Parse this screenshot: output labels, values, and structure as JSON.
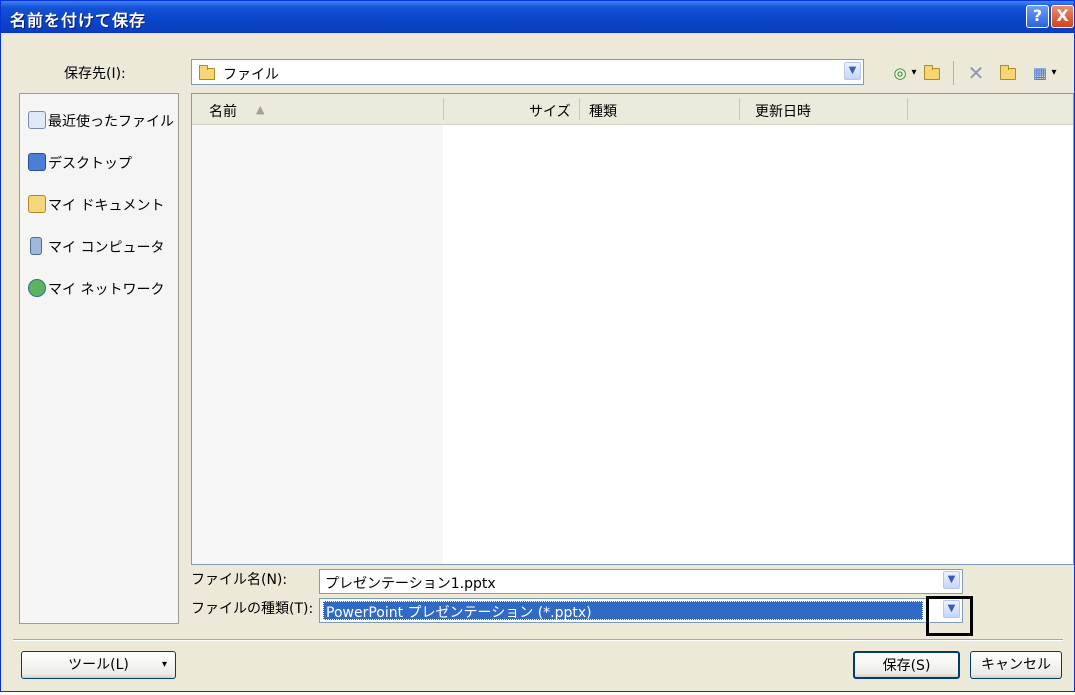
{
  "window": {
    "title": "名前を付けて保存"
  },
  "titlebar": {
    "help_glyph": "?",
    "close_glyph": "X"
  },
  "save_in": {
    "label": "保存先(I):",
    "value": "ファイル"
  },
  "places": [
    {
      "label": "最近使ったファイル",
      "icon": "recent-icon"
    },
    {
      "label": "デスクトップ",
      "icon": "desktop-icon"
    },
    {
      "label": "マイ ドキュメント",
      "icon": "my-documents-icon"
    },
    {
      "label": "マイ コンピュータ",
      "icon": "my-computer-icon"
    },
    {
      "label": "マイ ネットワーク",
      "icon": "my-network-icon"
    }
  ],
  "columns": {
    "name": "名前",
    "size": "サイズ",
    "type": "種類",
    "modified": "更新日時"
  },
  "filename": {
    "label": "ファイル名(N):",
    "value": "プレゼンテーション1.pptx"
  },
  "filetype": {
    "label": "ファイルの種類(T):",
    "value": "PowerPoint プレゼンテーション (*.pptx)"
  },
  "buttons": {
    "tools": "ツール(L)",
    "save": "保存(S)",
    "cancel": "キャンセル"
  },
  "colors": {
    "titlebar": "#0a46cc",
    "dialog_bg": "#ece9d8",
    "selection": "#316ac5"
  }
}
